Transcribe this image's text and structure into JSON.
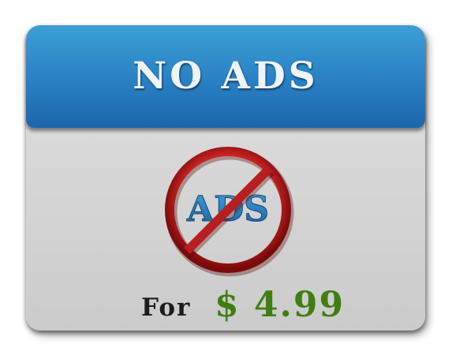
{
  "offer": {
    "title": "NO ADS",
    "icon": {
      "name": "no-ads-icon",
      "text": "ADS",
      "ring_color": "#c41a1e",
      "text_color": "#2a7fc4"
    },
    "price": {
      "prefix": "For",
      "value": "$ 4.99"
    }
  },
  "colors": {
    "header": "#2a83c6",
    "card": "#d6d6d6",
    "price": "#3f7f12",
    "label": "#1c1c1c"
  }
}
